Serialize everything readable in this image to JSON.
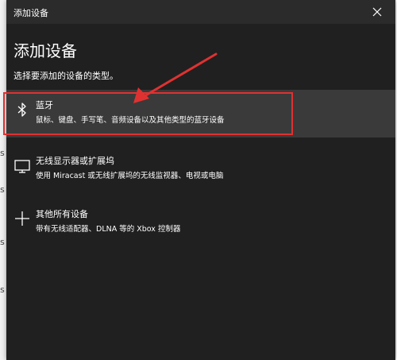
{
  "background_window": {
    "edge_glyphs": [
      "s",
      "s",
      "s",
      "s"
    ]
  },
  "dialog": {
    "title": "添加设备",
    "heading": "添加设备",
    "subheading": "选择要添加的设备的类型。",
    "close_icon": "close-icon",
    "options": [
      {
        "icon": "bluetooth-icon",
        "title": "蓝牙",
        "description": "鼠标、键盘、手写笔、音频设备以及其他类型的蓝牙设备",
        "selected": true
      },
      {
        "icon": "monitor-icon",
        "title": "无线显示器或扩展坞",
        "description": "使用 Miracast 或无线扩展坞的无线监视器、电视或电脑",
        "selected": false
      },
      {
        "icon": "plus-icon",
        "title": "其他所有设备",
        "description": "带有无线适配器、DLNA 等的 Xbox 控制器",
        "selected": false
      }
    ]
  },
  "annotation": {
    "highlight_color": "#e03131",
    "arrow_color": "#e03131"
  }
}
